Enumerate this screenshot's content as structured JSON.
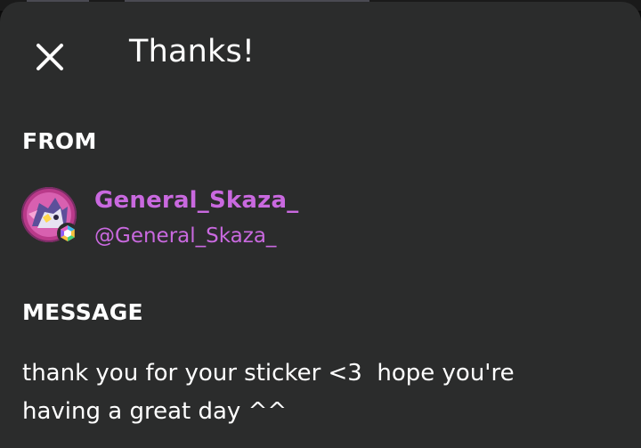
{
  "dialog": {
    "title": "Thanks!",
    "close_icon": "close-icon"
  },
  "from": {
    "label": "FROM",
    "display_name": "General_Skaza_",
    "handle": "@General_Skaza_",
    "avatar_icon": "user-avatar",
    "badge_icon": "hexagon-badge-icon"
  },
  "message": {
    "label": "MESSAGE",
    "text": "thank you for your sticker <3  hope you're\nhaving a great day ^^"
  },
  "colors": {
    "background": "#2b2c2c",
    "accent": "#c969df",
    "text": "#ffffff"
  }
}
